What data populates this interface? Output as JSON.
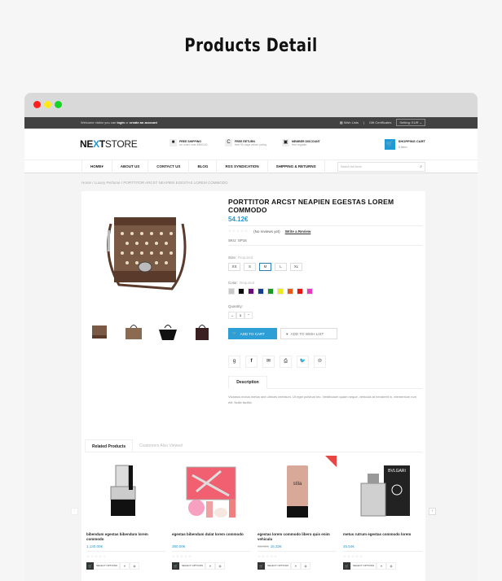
{
  "page_title": "Products Detail",
  "window": {
    "dots": [
      "#ff1f1f",
      "#ffe81a",
      "#16d425"
    ]
  },
  "topbar": {
    "welcome_prefix": "Welcome visitor you can",
    "login": "login",
    "or": "or",
    "create_account": "create an account",
    "wish_lists": "Wish Lists",
    "gift_certificates": "Gift Certificates",
    "setting": "Setting: EUR"
  },
  "header": {
    "logo_left": "NE",
    "logo_x": "X",
    "logo_t": "T",
    "logo_right": "STORE",
    "features": [
      {
        "icon": "truck-icon",
        "title": "FREE SHIPPING",
        "sub": "on order over $500.00"
      },
      {
        "icon": "return-icon",
        "title": "FREE RETURN",
        "sub": "free 90 days return policy"
      },
      {
        "icon": "discount-icon",
        "title": "MEMBER DISCOUNT",
        "sub": "free register"
      }
    ],
    "cart_title": "SHOPPING CART",
    "cart_count": "3 item"
  },
  "nav": {
    "items": [
      "HOME",
      "ABOUT US",
      "CONTACT US",
      "BLOG",
      "RSS SYNDICATION",
      "SHIPPING & RETURNS"
    ],
    "search_placeholder": "Search the store"
  },
  "breadcrumb": [
    "Home",
    "Luxury Perfume",
    "PORTTITOR ARCST NEAPIEN EGESTAS LOREM COMMODO"
  ],
  "product": {
    "title": "PORTTITOR ARCST NEAPIEN EGESTAS LOREM COMMODO",
    "price": "54.12€",
    "rating": 0,
    "reviews_text": "(No reviews yet)",
    "write_review": "Write a Review",
    "sku_label": "SKU:",
    "sku": "SP16",
    "size_label": "Size:",
    "required": "Required",
    "sizes": [
      "XS",
      "S",
      "M",
      "L",
      "XL"
    ],
    "selected_size": "M",
    "color_label": "Color:",
    "colors": [
      "#c8c8c8",
      "#0a0a0a",
      "#6a0a78",
      "#143c8c",
      "#1a9a22",
      "#f0ec1c",
      "#e85a14",
      "#e81414",
      "#e83cc0"
    ],
    "quantity_label": "Quantity:",
    "quantity": "1",
    "add_to_cart": "ADD TO CART",
    "add_to_wishlist": "ADD TO WISH LIST",
    "share_icons": [
      "google-plus-icon",
      "facebook-icon",
      "email-icon",
      "print-icon",
      "twitter-icon",
      "pinterest-icon"
    ],
    "description_tab": "Description",
    "description": "Vivamus lectus metus sed ultrices interdum. Ut eget pulvinar leo. Vestibulum quam neque, vehicula at hendrerit in, elementum non elit. Nulla facilisi."
  },
  "related": {
    "tabs": [
      "Related Products",
      "Customers Also Viewed"
    ],
    "products": [
      {
        "name": "bibendum egestas bibendum lorem commodo",
        "price": "1,130.00€",
        "old_price": "",
        "sale": false
      },
      {
        "name": "egestas bibendum dulat lorem commodo",
        "price": "380.00€",
        "old_price": "",
        "sale": false
      },
      {
        "name": "egestas lorem commodo libero quis enim vehicula",
        "price": "16.32€",
        "old_price": "40.00€",
        "sale": true
      },
      {
        "name": "metus rutrum egestas commodo lorem",
        "price": "45.54€",
        "old_price": "",
        "sale": false
      }
    ],
    "select_options": "SELECT OPTIONS"
  }
}
